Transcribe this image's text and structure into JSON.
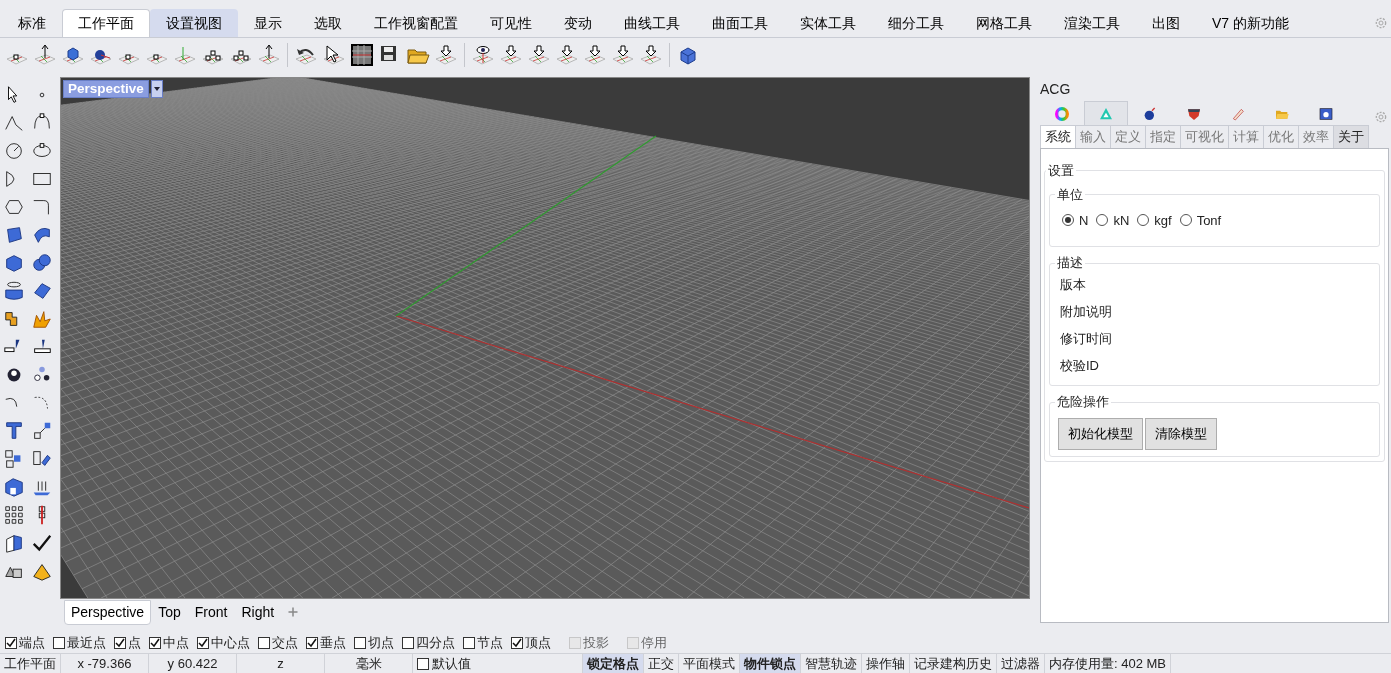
{
  "ribbon_tabs": [
    {
      "label": "标准",
      "selected": false,
      "highlighted": false
    },
    {
      "label": "工作平面",
      "selected": true,
      "highlighted": false
    },
    {
      "label": "设置视图",
      "selected": false,
      "highlighted": true
    },
    {
      "label": "显示",
      "selected": false,
      "highlighted": false
    },
    {
      "label": "选取",
      "selected": false,
      "highlighted": false
    },
    {
      "label": "工作视窗配置",
      "selected": false,
      "highlighted": false
    },
    {
      "label": "可见性",
      "selected": false,
      "highlighted": false
    },
    {
      "label": "变动",
      "selected": false,
      "highlighted": false
    },
    {
      "label": "曲线工具",
      "selected": false,
      "highlighted": false
    },
    {
      "label": "曲面工具",
      "selected": false,
      "highlighted": false
    },
    {
      "label": "实体工具",
      "selected": false,
      "highlighted": false
    },
    {
      "label": "细分工具",
      "selected": false,
      "highlighted": false
    },
    {
      "label": "网格工具",
      "selected": false,
      "highlighted": false
    },
    {
      "label": "渲染工具",
      "selected": false,
      "highlighted": false
    },
    {
      "label": "出图",
      "selected": false,
      "highlighted": false
    },
    {
      "label": "V7 的新功能",
      "selected": false,
      "highlighted": false
    }
  ],
  "viewport": {
    "title": "Perspective"
  },
  "viewport_tabs": [
    {
      "label": "Perspective",
      "selected": true
    },
    {
      "label": "Top",
      "selected": false
    },
    {
      "label": "Front",
      "selected": false
    },
    {
      "label": "Right",
      "selected": false
    }
  ],
  "osnaps": [
    {
      "label": "端点",
      "checked": true,
      "disabled": false
    },
    {
      "label": "最近点",
      "checked": false,
      "disabled": false
    },
    {
      "label": "点",
      "checked": true,
      "disabled": false
    },
    {
      "label": "中点",
      "checked": true,
      "disabled": false
    },
    {
      "label": "中心点",
      "checked": true,
      "disabled": false
    },
    {
      "label": "交点",
      "checked": false,
      "disabled": false
    },
    {
      "label": "垂点",
      "checked": true,
      "disabled": false
    },
    {
      "label": "切点",
      "checked": false,
      "disabled": false
    },
    {
      "label": "四分点",
      "checked": false,
      "disabled": false
    },
    {
      "label": "节点",
      "checked": false,
      "disabled": false
    },
    {
      "label": "顶点",
      "checked": true,
      "disabled": false
    },
    {
      "label": "投影",
      "checked": false,
      "disabled": true
    },
    {
      "label": "停用",
      "checked": false,
      "disabled": true
    }
  ],
  "status_bar": [
    {
      "kind": "label",
      "text": "工作平面"
    },
    {
      "kind": "coord",
      "text": "x -79.366"
    },
    {
      "kind": "coord",
      "text": "y 60.422"
    },
    {
      "kind": "coord",
      "text": "z"
    },
    {
      "kind": "coord",
      "text": "毫米"
    },
    {
      "kind": "checkbox",
      "text": "默认值",
      "checked": false
    },
    {
      "kind": "toggle",
      "text": "锁定格点",
      "on": true
    },
    {
      "kind": "toggle",
      "text": "正交",
      "on": false
    },
    {
      "kind": "toggle",
      "text": "平面模式",
      "on": false
    },
    {
      "kind": "toggle",
      "text": "物件锁点",
      "on": true
    },
    {
      "kind": "toggle",
      "text": "智慧轨迹",
      "on": false
    },
    {
      "kind": "toggle",
      "text": "操作轴",
      "on": false
    },
    {
      "kind": "toggle",
      "text": "记录建构历史",
      "on": false
    },
    {
      "kind": "toggle",
      "text": "过滤器",
      "on": false
    },
    {
      "kind": "label",
      "text": "内存使用量: 402 MB"
    }
  ],
  "panel": {
    "title": "ACG",
    "icon_tabs": [
      {
        "kind": "color-wheel",
        "selected": false
      },
      {
        "kind": "triangle",
        "selected": true
      },
      {
        "kind": "bomb",
        "selected": false
      },
      {
        "kind": "shield",
        "selected": false
      },
      {
        "kind": "pen",
        "selected": false
      },
      {
        "kind": "folder",
        "selected": false
      },
      {
        "kind": "help-window",
        "selected": false
      }
    ],
    "tabs": [
      {
        "label": "系统",
        "selected": true,
        "highlighted": false
      },
      {
        "label": "输入",
        "selected": false,
        "highlighted": false
      },
      {
        "label": "定义",
        "selected": false,
        "highlighted": false
      },
      {
        "label": "指定",
        "selected": false,
        "highlighted": false
      },
      {
        "label": "可视化",
        "selected": false,
        "highlighted": false
      },
      {
        "label": "计算",
        "selected": false,
        "highlighted": false
      },
      {
        "label": "优化",
        "selected": false,
        "highlighted": false
      },
      {
        "label": "效率",
        "selected": false,
        "highlighted": false
      },
      {
        "label": "关于",
        "selected": false,
        "highlighted": true
      }
    ],
    "settings": {
      "title": "设置",
      "units": {
        "title": "单位",
        "options": [
          {
            "label": "N",
            "selected": true
          },
          {
            "label": "kN",
            "selected": false
          },
          {
            "label": "kgf",
            "selected": false
          },
          {
            "label": "Tonf",
            "selected": false
          }
        ]
      },
      "description": {
        "title": "描述",
        "rows": [
          "版本",
          "附加说明",
          "修订时间",
          "校验ID"
        ]
      },
      "danger": {
        "title": "危险操作",
        "buttons": [
          "初始化模型",
          "清除模型"
        ]
      }
    }
  }
}
